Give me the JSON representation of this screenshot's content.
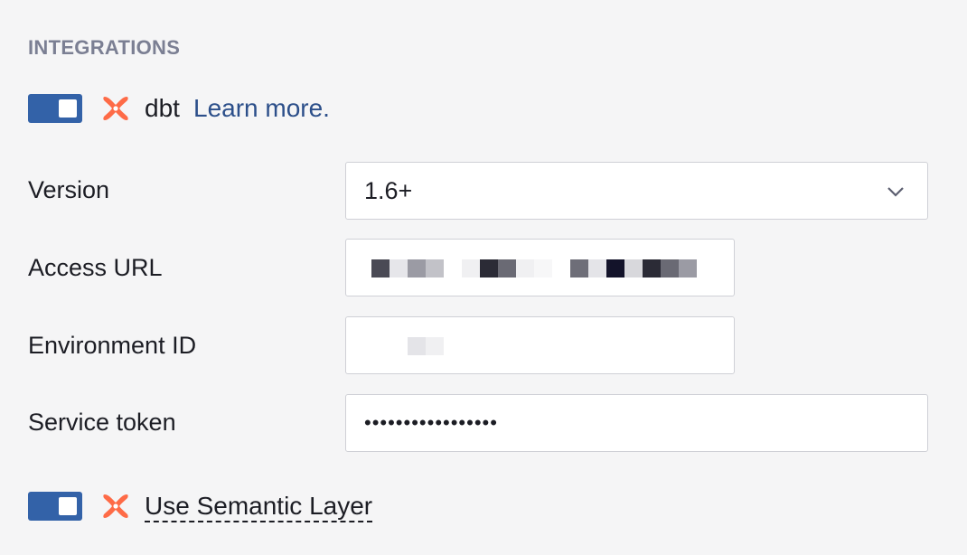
{
  "section": {
    "heading": "INTEGRATIONS"
  },
  "dbt": {
    "enabled": true,
    "logo_icon": "dbt-logo-icon",
    "name": "dbt",
    "learn_more": "Learn more."
  },
  "fields": {
    "version": {
      "label": "Version",
      "value": "1.6+"
    },
    "access_url": {
      "label": "Access URL",
      "value": ""
    },
    "environment_id": {
      "label": "Environment ID",
      "value": ""
    },
    "service_token": {
      "label": "Service token",
      "value": "•••••••••••••••••"
    }
  },
  "semantic_layer": {
    "enabled": true,
    "label": "Use Semantic Layer"
  },
  "colors": {
    "toggle_on": "#3362a8",
    "link": "#2c4f8a",
    "dbt_orange": "#fe6b47",
    "heading": "#7b7f93"
  }
}
